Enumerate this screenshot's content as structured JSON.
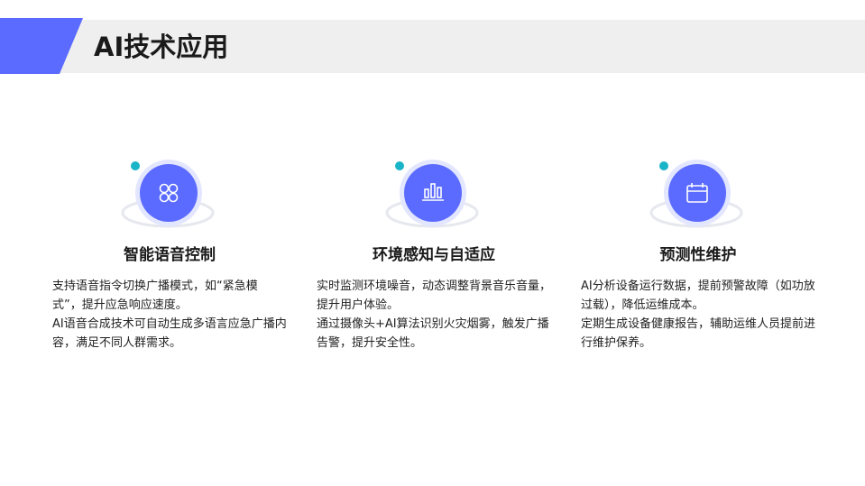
{
  "header": {
    "title": "AI技术应用"
  },
  "colors": {
    "accent": "#5b6bff",
    "accent_light": "#e3e6ff",
    "dot": "#19b4c8",
    "band": "#efefef"
  },
  "cards": [
    {
      "icon": "grid-icon",
      "title": "智能语音控制",
      "lines": [
        "支持语音指令切换广播模式，如“紧急模式”，提升应急响应速度。",
        "AI语音合成技术可自动生成多语言应急广播内容，满足不同人群需求。"
      ]
    },
    {
      "icon": "bar-chart-icon",
      "title": "环境感知与自适应",
      "lines": [
        "实时监测环境噪音，动态调整背景音乐音量，提升用户体验。",
        "通过摄像头+AI算法识别火灾烟雾，触发广播告警，提升安全性。"
      ]
    },
    {
      "icon": "calendar-icon",
      "title": "预测性维护",
      "lines": [
        "AI分析设备运行数据，提前预警故障（如功放过载），降低运维成本。",
        "定期生成设备健康报告，辅助运维人员提前进行维护保养。"
      ]
    }
  ]
}
